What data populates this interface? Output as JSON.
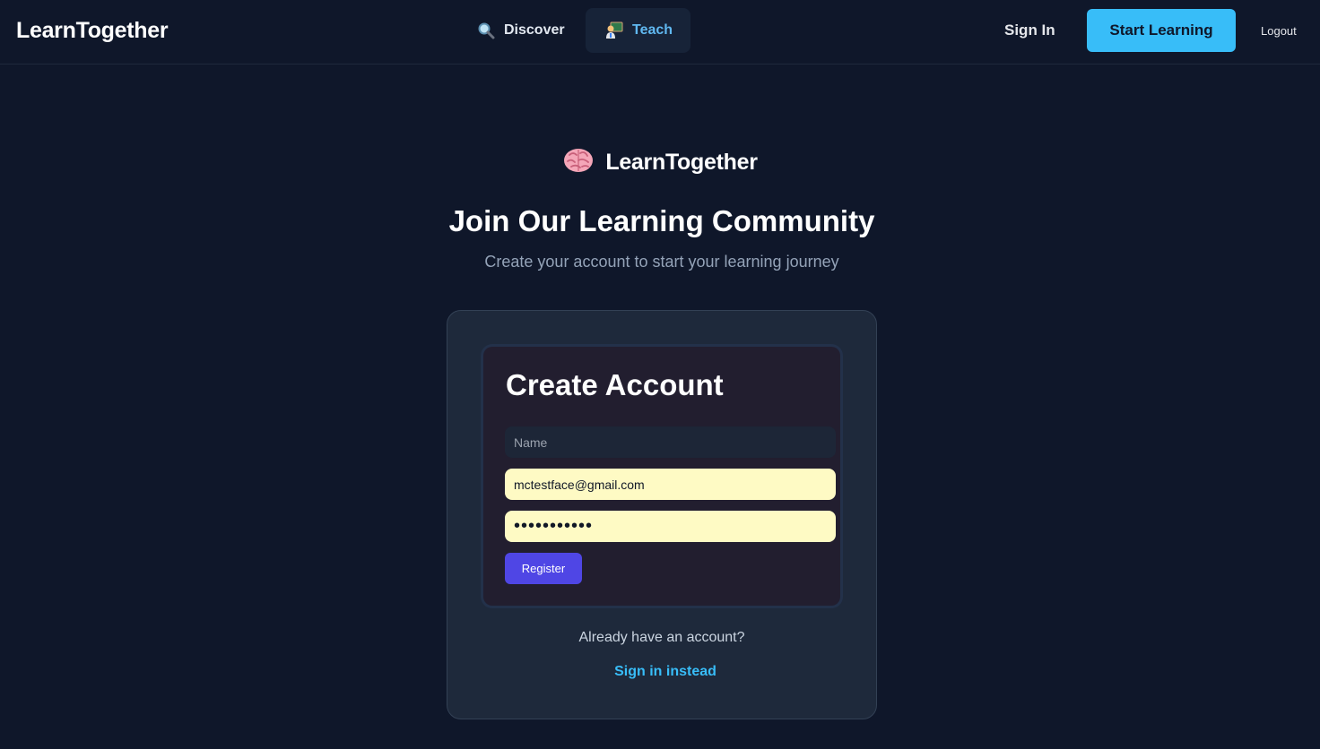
{
  "nav": {
    "brand": "LearnTogether",
    "links": [
      {
        "label": "Discover",
        "icon": "magnifier-icon"
      },
      {
        "label": "Teach",
        "icon": "teacher-icon"
      }
    ],
    "sign_in": "Sign In",
    "start_learning": "Start Learning",
    "logout": "Logout"
  },
  "hero": {
    "brand": "LearnTogether",
    "brand_icon": "brain-icon",
    "title": "Join Our Learning Community",
    "subtitle": "Create your account to start your learning journey"
  },
  "form": {
    "title": "Create Account",
    "name_placeholder": "Name",
    "name_value": "",
    "email_value": "mctestface@gmail.com",
    "password_value": "•••••••••••",
    "register_label": "Register"
  },
  "footer": {
    "already": "Already have an account?",
    "sign_in_instead": "Sign in instead"
  },
  "colors": {
    "background": "#0f172a",
    "accent": "#38bdf8",
    "register": "#4f46e5",
    "autofill": "#fefac4"
  }
}
